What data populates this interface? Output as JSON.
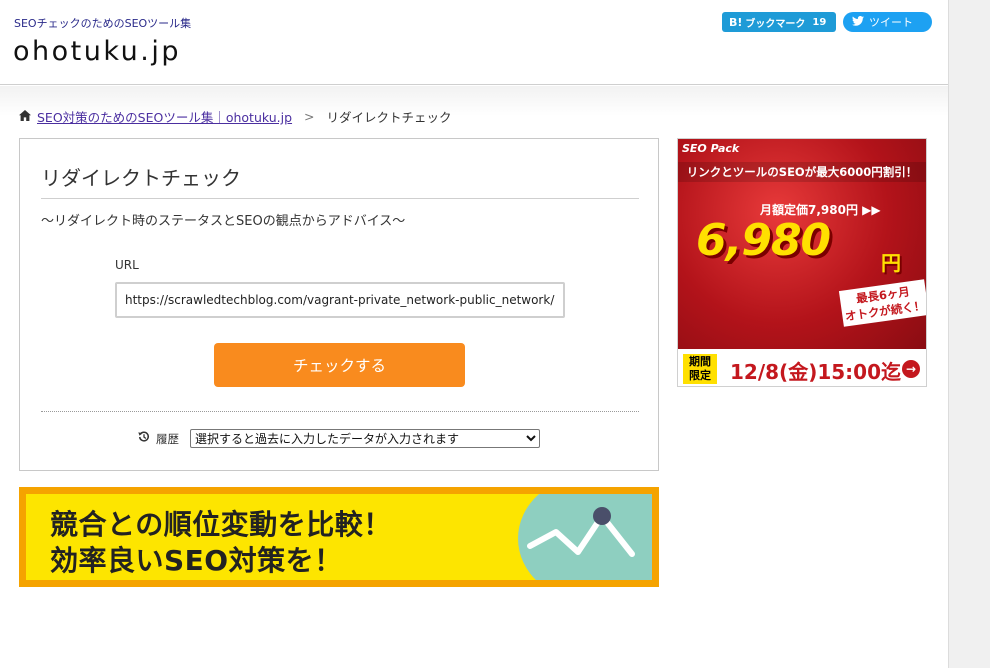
{
  "header": {
    "tagline": "SEOチェックのためのSEOツール集",
    "logo": "ohotuku.jp",
    "hatena_label": "ブックマーク",
    "hatena_count": "19",
    "hatena_b": "B!",
    "tweet_label": "ツイート"
  },
  "breadcrumb": {
    "home_label": "SEO対策のためのSEOツール集｜ohotuku.jp",
    "separator": ">",
    "current": "リダイレクトチェック"
  },
  "tool": {
    "title": "リダイレクトチェック",
    "subtitle": "〜リダイレクト時のステータスとSEOの観点からアドバイス〜",
    "url_label": "URL",
    "url_value": "https://scrawledtechblog.com/vagrant-private_network-public_network/",
    "check_button": "チェックする",
    "history_label": "履歴",
    "history_selected": "選択すると過去に入力したデータが入力されます"
  },
  "banner": {
    "line1": "競合との順位変動を比較！",
    "line2": "効率良いSEO対策を！"
  },
  "ad": {
    "brand": "SEO Pack",
    "headline": "リンクとツールのSEOが最大6000円割引！",
    "regular_price": "月額定価7,980円 ▶▶",
    "price": "6,980",
    "price_unit": "円",
    "promo_line1": "最長6ヶ月",
    "promo_line2": "オトクが続く！",
    "limited_line1": "期間",
    "limited_line2": "限定",
    "deadline": "12/8(金)15:00迄",
    "arrow": "→"
  },
  "colors": {
    "check_button": "#f98b1e",
    "banner_border": "#f5a300",
    "banner_fill": "#fde500",
    "ad_red": "#c4181e",
    "hatena_blue": "#1e9bd7",
    "twitter_blue": "#1da1f2"
  }
}
